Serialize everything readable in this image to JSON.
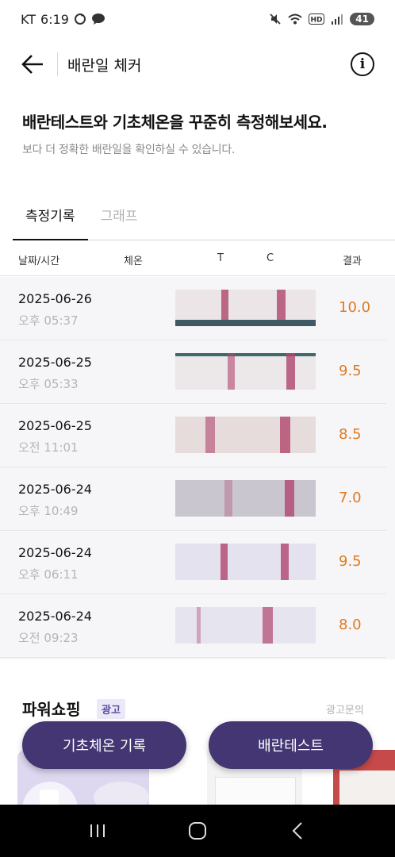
{
  "status": {
    "carrier": "KT",
    "time": "6:19",
    "battery": "41"
  },
  "header": {
    "title": "배란일 체커"
  },
  "intro": {
    "title": "배란테스트와 기초체온을 꾸준히 측정해보세요.",
    "subtitle": "보다 더 정확한 배란일을 확인하실 수 있습니다."
  },
  "tabs": [
    {
      "label": "측정기록",
      "active": true
    },
    {
      "label": "그래프",
      "active": false
    }
  ],
  "table": {
    "headers": {
      "datetime": "날짜/시간",
      "temp": "체온",
      "t": "T",
      "c": "C",
      "result": "결과"
    },
    "rows": [
      {
        "date": "2025-06-26",
        "time": "오후 05:37",
        "result": "10.0"
      },
      {
        "date": "2025-06-25",
        "time": "오후 05:33",
        "result": "9.5"
      },
      {
        "date": "2025-06-25",
        "time": "오전 11:01",
        "result": "8.5"
      },
      {
        "date": "2025-06-24",
        "time": "오후 10:49",
        "result": "7.0"
      },
      {
        "date": "2025-06-24",
        "time": "오후 06:11",
        "result": "9.5"
      },
      {
        "date": "2025-06-24",
        "time": "오전 09:23",
        "result": "8.0"
      }
    ]
  },
  "shopping": {
    "title": "파워쇼핑",
    "ad_badge": "광고",
    "ad_inquiry": "광고문의"
  },
  "buttons": {
    "bbt_record": "기초체온 기록",
    "ovulation_test": "배란테스트"
  },
  "colors": {
    "accent_purple": "#433672",
    "result_orange": "#e07a1f",
    "test_line": "#b0466e"
  }
}
